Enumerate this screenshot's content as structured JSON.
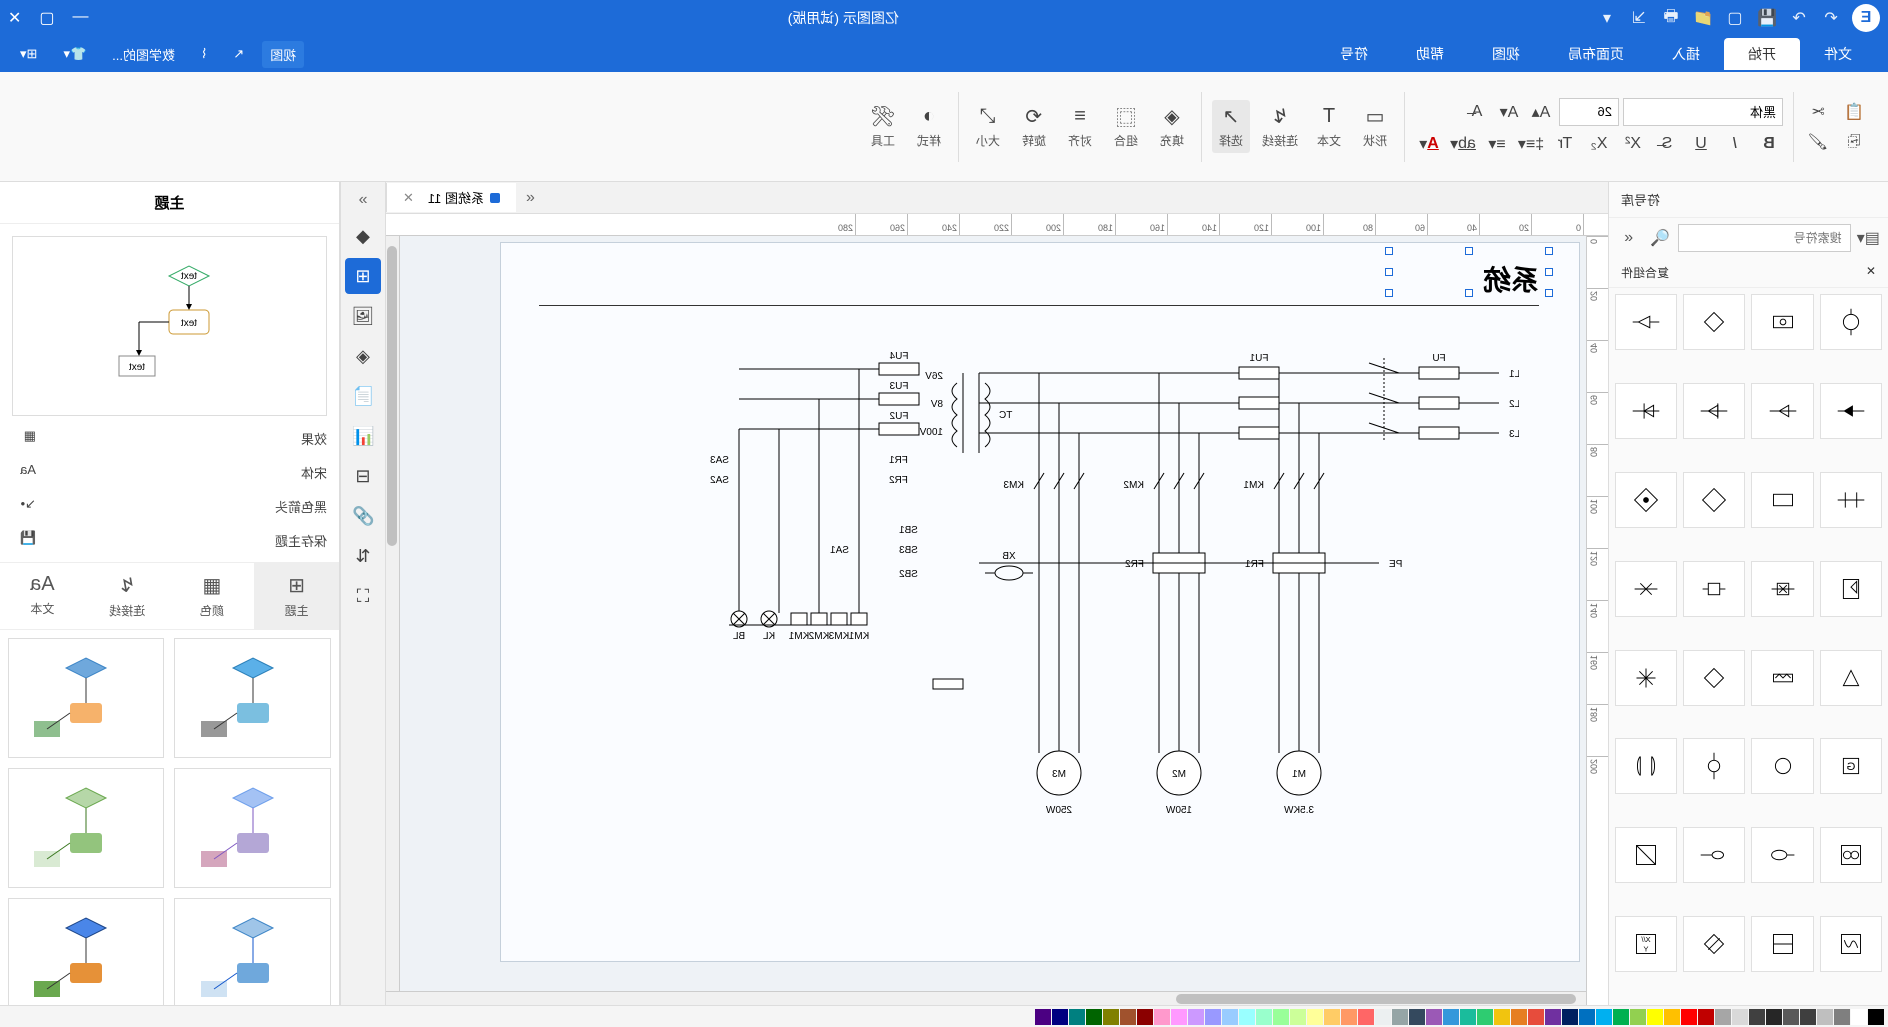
{
  "window": {
    "title": "亿图图示 (试用版)"
  },
  "menus": [
    "文件",
    "开始",
    "插入",
    "页面布局",
    "视图",
    "帮助",
    "符号"
  ],
  "menu_active": 1,
  "right_menu": {
    "view": "视图",
    "arrow_tip": "数学图的..."
  },
  "ribbon": {
    "font_name": "黑体",
    "font_size": "26",
    "groups": {
      "select": "选择",
      "connector": "连接线",
      "text": "文本",
      "shape": "形状",
      "fill": "填充",
      "group": "组合",
      "align": "对齐",
      "rotate": "旋转",
      "size": "大小",
      "style": "样式",
      "tools": "工具"
    }
  },
  "tab": {
    "name": "系统图 11"
  },
  "ruler_h": [
    "0",
    "20",
    "40",
    "60",
    "80",
    "100",
    "120",
    "140",
    "160",
    "180",
    "200",
    "220",
    "240",
    "260",
    "280"
  ],
  "ruler_v": [
    "0",
    "20",
    "40",
    "60",
    "80",
    "100",
    "120",
    "140",
    "160",
    "180",
    "200"
  ],
  "canvas": {
    "title": "系统",
    "labels": {
      "L1": "L1",
      "L2": "L2",
      "L3": "L3",
      "PE": "PE",
      "FU": "FU",
      "FU1": "FU1",
      "FU2": "FU2",
      "FU3": "FU3",
      "FU4": "FU4",
      "KM1": "KM1",
      "KM2": "KM2",
      "KM3": "KM3",
      "FR1": "FR1",
      "FR2": "FR2",
      "M1": "M1",
      "M2": "M2",
      "M3": "M3",
      "p_M1": "3.5KW",
      "p_M2": "150W",
      "p_M3": "250W",
      "TC": "TC",
      "v_100": "100V",
      "v_8": "8V",
      "v_26": "26V",
      "SA1": "SA1",
      "SA2": "SA2",
      "SA3": "SA3",
      "SB1": "SB1",
      "SB2": "SB2",
      "SB3": "SB3",
      "KL": "KL",
      "BL": "BL",
      "XB": "XB"
    }
  },
  "left": {
    "title": "符号库",
    "search_ph": "搜索符号",
    "section": "复合组件"
  },
  "right": {
    "title": "主题",
    "opts": {
      "effect": "效果",
      "font": "宋体",
      "conn": "黑色箭头",
      "save": "保存主题"
    },
    "tabs": {
      "theme": "主题",
      "color": "颜色",
      "conn": "连接线",
      "text": "文本"
    }
  },
  "colors": [
    "#000000",
    "#ffffff",
    "#7f7f7f",
    "#bfbfbf",
    "#3f3f3f",
    "#595959",
    "#262626",
    "#404040",
    "#d9d9d9",
    "#a6a6a6",
    "#c00000",
    "#ff0000",
    "#ffc000",
    "#ffff00",
    "#92d050",
    "#00b050",
    "#00b0f0",
    "#0070c0",
    "#002060",
    "#7030a0",
    "#e74c3c",
    "#e67e22",
    "#f1c40f",
    "#2ecc71",
    "#1abc9c",
    "#3498db",
    "#9b59b6",
    "#34495e",
    "#95a5a6",
    "#ecf0f1",
    "#ff6666",
    "#ff9966",
    "#ffcc66",
    "#ffff99",
    "#ccff99",
    "#99ff99",
    "#99ffcc",
    "#99ffff",
    "#99ccff",
    "#9999ff",
    "#cc99ff",
    "#ff99ff",
    "#ff99cc",
    "#8b0000",
    "#a0522d",
    "#808000",
    "#006400",
    "#008080",
    "#000080",
    "#4b0082"
  ]
}
